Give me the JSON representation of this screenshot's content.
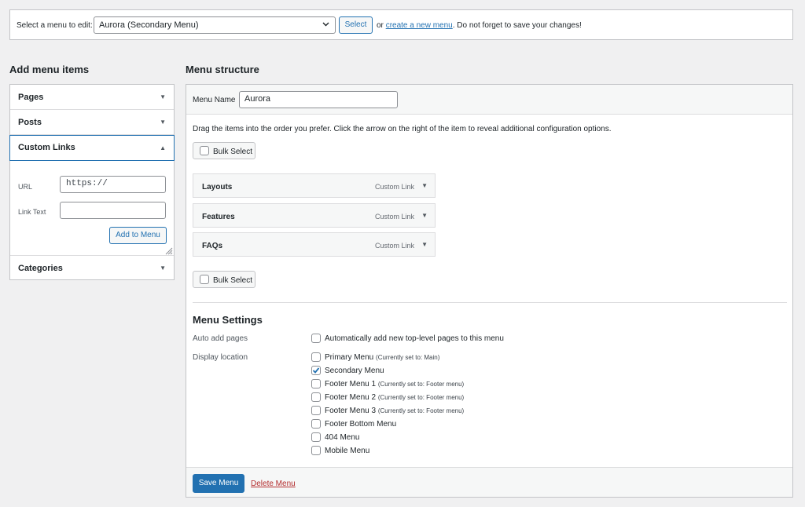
{
  "select_bar": {
    "label": "Select a menu to edit:",
    "selected_menu": "Aurora (Secondary Menu)",
    "select_button": "Select",
    "note_prefix": "or",
    "create_link": "create a new menu",
    "note_suffix": ". Do not forget to save your changes!"
  },
  "add_items": {
    "heading": "Add menu items",
    "sections": [
      {
        "label": "Pages",
        "expanded": false
      },
      {
        "label": "Posts",
        "expanded": false
      },
      {
        "label": "Custom Links",
        "expanded": true
      },
      {
        "label": "Categories",
        "expanded": false
      }
    ],
    "custom_links": {
      "url_label": "URL",
      "url_value": "https://",
      "link_text_label": "Link Text",
      "link_text_value": "",
      "add_button": "Add to Menu"
    }
  },
  "menu_structure": {
    "heading": "Menu structure",
    "menu_name_label": "Menu Name",
    "menu_name_value": "Aurora",
    "instructions": "Drag the items into the order you prefer. Click the arrow on the right of the item to reveal additional configuration options.",
    "bulk_select_label": "Bulk Select",
    "items": [
      {
        "title": "Layouts",
        "type": "Custom Link"
      },
      {
        "title": "Features",
        "type": "Custom Link"
      },
      {
        "title": "FAQs",
        "type": "Custom Link"
      }
    ]
  },
  "menu_settings": {
    "heading": "Menu Settings",
    "auto_add_label": "Auto add pages",
    "auto_add_option": "Automatically add new top-level pages to this menu",
    "auto_add_checked": false,
    "display_location_label": "Display location",
    "locations": [
      {
        "label": "Primary Menu",
        "sub": "(Currently set to: Main)",
        "checked": false
      },
      {
        "label": "Secondary Menu",
        "sub": "",
        "checked": true
      },
      {
        "label": "Footer Menu 1",
        "sub": "(Currently set to: Footer menu)",
        "checked": false
      },
      {
        "label": "Footer Menu 2",
        "sub": "(Currently set to: Footer menu)",
        "checked": false
      },
      {
        "label": "Footer Menu 3",
        "sub": "(Currently set to: Footer menu)",
        "checked": false
      },
      {
        "label": "Footer Bottom Menu",
        "sub": "",
        "checked": false
      },
      {
        "label": "404 Menu",
        "sub": "",
        "checked": false
      },
      {
        "label": "Mobile Menu",
        "sub": "",
        "checked": false
      }
    ]
  },
  "footer": {
    "save_button": "Save Menu",
    "delete_link": "Delete Menu"
  },
  "colors": {
    "accent": "#2271b1",
    "danger": "#b32d2e",
    "background": "#f0f0f1"
  }
}
